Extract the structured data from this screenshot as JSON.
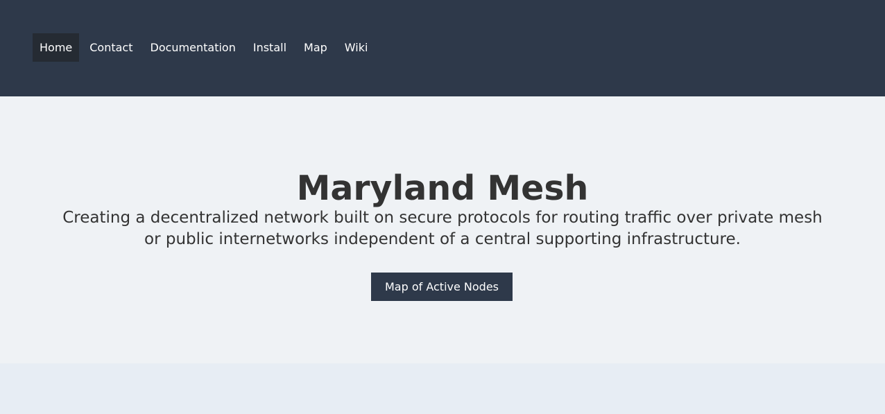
{
  "nav": {
    "items": [
      {
        "label": "Home",
        "active": true
      },
      {
        "label": "Contact",
        "active": false
      },
      {
        "label": "Documentation",
        "active": false
      },
      {
        "label": "Install",
        "active": false
      },
      {
        "label": "Map",
        "active": false
      },
      {
        "label": "Wiki",
        "active": false
      }
    ]
  },
  "hero": {
    "title": "Maryland Mesh",
    "subtitle": "Creating a decentralized network built on secure protocols for routing traffic over private mesh or public internetworks independent of a central supporting infrastructure.",
    "button_label": "Map of Active Nodes"
  },
  "colors": {
    "header_bg": "#2e394a",
    "nav_active_bg": "#252b33",
    "hero_bg": "#eff2f5",
    "page_bg": "#e7edf4",
    "text": "#333333",
    "button_bg": "#2e394a"
  }
}
